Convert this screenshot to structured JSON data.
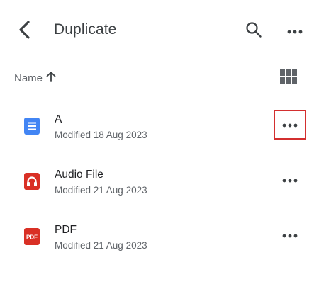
{
  "header": {
    "title": "Duplicate",
    "back_icon": "chevron-left-icon",
    "search_icon": "search-icon",
    "more_icon": "more-horizontal-icon"
  },
  "sort": {
    "label": "Name",
    "direction_icon": "arrow-up-icon",
    "view_toggle_icon": "grid-view-icon"
  },
  "files": [
    {
      "name": "A",
      "modified": "Modified 18 Aug 2023",
      "type": "document",
      "icon": "docs-icon",
      "icon_color": "#4285f4",
      "selected_menu": true
    },
    {
      "name": "Audio File",
      "modified": "Modified 21 Aug 2023",
      "type": "audio",
      "icon": "audio-file-icon",
      "icon_color": "#d93025",
      "selected_menu": false
    },
    {
      "name": "PDF",
      "modified": "Modified 21 Aug 2023",
      "type": "pdf",
      "icon": "pdf-icon",
      "icon_color": "#d93025",
      "icon_text": "PDF",
      "selected_menu": false
    }
  ],
  "colors": {
    "highlight_border": "#d32f2f",
    "secondary_text": "#5f6368",
    "icon_gray": "#5f6368"
  }
}
